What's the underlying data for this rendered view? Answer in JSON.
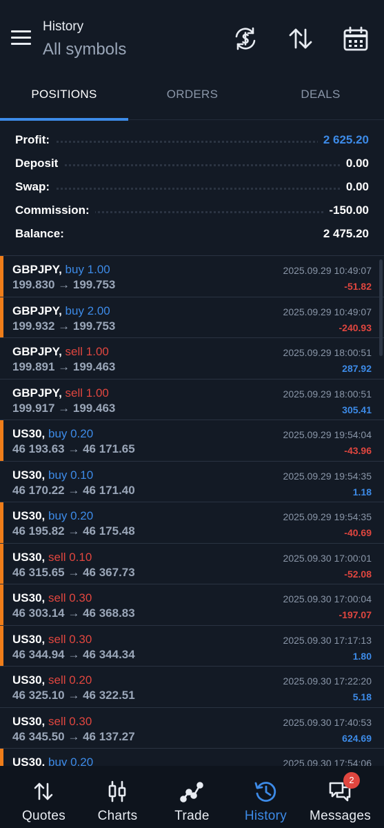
{
  "header": {
    "title": "History",
    "subtitle": "All symbols"
  },
  "tabs": [
    {
      "label": "POSITIONS",
      "active": true
    },
    {
      "label": "ORDERS",
      "active": false
    },
    {
      "label": "DEALS",
      "active": false
    }
  ],
  "summary": [
    {
      "label": "Profit:",
      "value": "2 625.20",
      "highlight": true
    },
    {
      "label": "Deposit",
      "value": "0.00"
    },
    {
      "label": "Swap:",
      "value": "0.00"
    },
    {
      "label": "Commission:",
      "value": "-150.00"
    },
    {
      "label": "Balance:",
      "value": "2 475.20"
    }
  ],
  "deals": [
    {
      "symbol": "GBPJPY,",
      "side": "buy 1.00",
      "type": "buy",
      "prices": "199.830 → 199.753",
      "time": "2025.09.29 10:49:07",
      "pl": "-51.82",
      "marker": true
    },
    {
      "symbol": "GBPJPY,",
      "side": "buy 2.00",
      "type": "buy",
      "prices": "199.932 → 199.753",
      "time": "2025.09.29 10:49:07",
      "pl": "-240.93",
      "marker": true
    },
    {
      "symbol": "GBPJPY,",
      "side": "sell 1.00",
      "type": "sell",
      "prices": "199.891 → 199.463",
      "time": "2025.09.29 18:00:51",
      "pl": "287.92",
      "marker": false
    },
    {
      "symbol": "GBPJPY,",
      "side": "sell 1.00",
      "type": "sell",
      "prices": "199.917 → 199.463",
      "time": "2025.09.29 18:00:51",
      "pl": "305.41",
      "marker": false
    },
    {
      "symbol": "US30,",
      "side": "buy 0.20",
      "type": "buy",
      "prices": "46 193.63 → 46 171.65",
      "time": "2025.09.29 19:54:04",
      "pl": "-43.96",
      "marker": true
    },
    {
      "symbol": "US30,",
      "side": "buy 0.10",
      "type": "buy",
      "prices": "46 170.22 → 46 171.40",
      "time": "2025.09.29 19:54:35",
      "pl": "1.18",
      "marker": false
    },
    {
      "symbol": "US30,",
      "side": "buy 0.20",
      "type": "buy",
      "prices": "46 195.82 → 46 175.48",
      "time": "2025.09.29 19:54:35",
      "pl": "-40.69",
      "marker": true
    },
    {
      "symbol": "US30,",
      "side": "sell 0.10",
      "type": "sell",
      "prices": "46 315.65 → 46 367.73",
      "time": "2025.09.30 17:00:01",
      "pl": "-52.08",
      "marker": true
    },
    {
      "symbol": "US30,",
      "side": "sell 0.30",
      "type": "sell",
      "prices": "46 303.14 → 46 368.83",
      "time": "2025.09.30 17:00:04",
      "pl": "-197.07",
      "marker": true
    },
    {
      "symbol": "US30,",
      "side": "sell 0.30",
      "type": "sell",
      "prices": "46 344.94 → 46 344.34",
      "time": "2025.09.30 17:17:13",
      "pl": "1.80",
      "marker": true
    },
    {
      "symbol": "US30,",
      "side": "sell 0.20",
      "type": "sell",
      "prices": "46 325.10 → 46 322.51",
      "time": "2025.09.30 17:22:20",
      "pl": "5.18",
      "marker": false
    },
    {
      "symbol": "US30,",
      "side": "sell 0.30",
      "type": "sell",
      "prices": "46 345.50 → 46 137.27",
      "time": "2025.09.30 17:40:53",
      "pl": "624.69",
      "marker": false
    },
    {
      "symbol": "US30,",
      "side": "buy 0.20",
      "type": "buy",
      "prices": "",
      "time": "2025.09.30 17:54:06",
      "pl": "",
      "marker": true
    }
  ],
  "nav": [
    {
      "label": "Quotes",
      "icon": "quotes-icon",
      "active": false
    },
    {
      "label": "Charts",
      "icon": "charts-icon",
      "active": false
    },
    {
      "label": "Trade",
      "icon": "trade-icon",
      "active": false
    },
    {
      "label": "History",
      "icon": "history-icon",
      "active": true
    },
    {
      "label": "Messages",
      "icon": "messages-icon",
      "active": false,
      "badge": "2"
    }
  ],
  "colors": {
    "accent": "#3d8be8",
    "loss": "#e0463f",
    "marker": "#ef7d1a",
    "background": "#131a25"
  }
}
